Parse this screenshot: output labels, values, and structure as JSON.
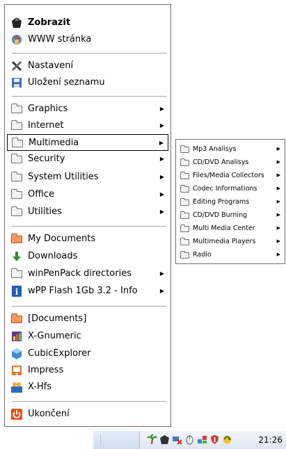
{
  "menu": {
    "top": [
      {
        "label": "Zobrazit",
        "icon": "black-gem-icon",
        "bold": true
      },
      {
        "label": "WWW stránka",
        "icon": "globe-house-icon"
      }
    ],
    "settings": [
      {
        "label": "Nastavení",
        "icon": "tools-icon"
      },
      {
        "label": "Uložení seznamu",
        "icon": "floppy-save-icon"
      }
    ],
    "categories": [
      {
        "label": "Graphics",
        "icon": "folder-icon",
        "has_submenu": true
      },
      {
        "label": "Internet",
        "icon": "folder-icon",
        "has_submenu": true
      },
      {
        "label": "Multimedia",
        "icon": "folder-icon",
        "has_submenu": true,
        "highlighted": true
      },
      {
        "label": "Security",
        "icon": "folder-icon",
        "has_submenu": true
      },
      {
        "label": "System Utilities",
        "icon": "folder-icon",
        "has_submenu": true
      },
      {
        "label": "Office",
        "icon": "folder-icon",
        "has_submenu": true
      },
      {
        "label": "Utilities",
        "icon": "folder-icon",
        "has_submenu": true
      }
    ],
    "places": [
      {
        "label": "My Documents",
        "icon": "orange-folder-icon"
      },
      {
        "label": "Downloads",
        "icon": "green-down-arrow-icon"
      },
      {
        "label": "winPenPack directories",
        "icon": "folder-icon",
        "has_submenu": true
      },
      {
        "label": "wPP Flash 1Gb 3.2 - Info",
        "icon": "info-icon",
        "has_submenu": true
      }
    ],
    "apps": [
      {
        "label": "[Documents]",
        "icon": "orange-folder-icon"
      },
      {
        "label": "X-Gnumeric",
        "icon": "gnumeric-icon"
      },
      {
        "label": "CubicExplorer",
        "icon": "cubicexplorer-icon"
      },
      {
        "label": "Impress",
        "icon": "impress-icon"
      },
      {
        "label": "X-Hfs",
        "icon": "hfs-icon"
      }
    ],
    "exit": {
      "label": "Ukončení",
      "icon": "power-icon"
    }
  },
  "submenu": {
    "items": [
      {
        "label": "Mp3 Analisys"
      },
      {
        "label": "CD/DVD Analisys"
      },
      {
        "label": "Files/Media Collectors"
      },
      {
        "label": "Codec Informations"
      },
      {
        "label": "Editing Programs"
      },
      {
        "label": "CD/DVD Burning"
      },
      {
        "label": "Multi Media Center"
      },
      {
        "label": "Multimedia Players"
      },
      {
        "label": "Radio"
      }
    ]
  },
  "taskbar": {
    "clock": "21:26",
    "tray_icons": [
      "palm-tree-icon",
      "gem-icon",
      "network-icon",
      "mouse-icon",
      "network-flag-icon",
      "shield-icon",
      "refresh-icon"
    ]
  },
  "colors": {
    "highlight_border": "#000000",
    "menu_border": "#6f6f6f",
    "separator": "#a8a8a8"
  }
}
